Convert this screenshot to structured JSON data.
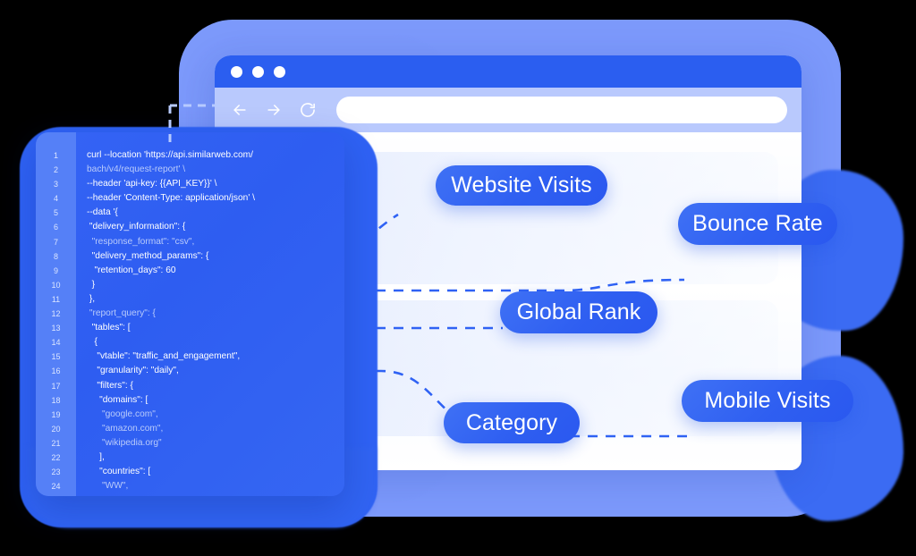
{
  "browser": {
    "traffic_lights": [
      "close",
      "minimize",
      "maximize"
    ],
    "nav": {
      "back_label": "Back",
      "forward_label": "Forward",
      "reload_label": "Reload"
    },
    "address_bar": {
      "value": "",
      "placeholder": ""
    }
  },
  "pills": [
    {
      "id": "website-visits",
      "label": "Website Visits"
    },
    {
      "id": "bounce-rate",
      "label": "Bounce Rate"
    },
    {
      "id": "global-rank",
      "label": "Global Rank"
    },
    {
      "id": "category",
      "label": "Category"
    },
    {
      "id": "mobile-visits",
      "label": "Mobile Visits"
    }
  ],
  "code_panel": {
    "language": "shell",
    "line_numbers": [
      1,
      2,
      3,
      4,
      5,
      6,
      7,
      8,
      9,
      10,
      11,
      12,
      13,
      14,
      15,
      16,
      17,
      18,
      19,
      20,
      21,
      22,
      23,
      24
    ],
    "lines": [
      {
        "n": 1,
        "text": "curl --location 'https://api.similarweb.com/",
        "dim": false
      },
      {
        "n": 2,
        "text": "bach/v4/request-report' \\",
        "dim": true
      },
      {
        "n": 3,
        "text": "--header 'api-key: {{API_KEY}}' \\",
        "dim": false
      },
      {
        "n": 4,
        "text": "--header 'Content-Type: application/json' \\",
        "dim": false
      },
      {
        "n": 5,
        "text": "--data '{",
        "dim": false
      },
      {
        "n": 6,
        "text": " \"delivery_information\": {",
        "dim": false
      },
      {
        "n": 7,
        "text": "  \"response_format\": \"csv\",",
        "dim": true
      },
      {
        "n": 8,
        "text": "  \"delivery_method_params\": {",
        "dim": false
      },
      {
        "n": 9,
        "text": "   \"retention_days\": 60",
        "dim": false
      },
      {
        "n": 10,
        "text": "  }",
        "dim": false
      },
      {
        "n": 11,
        "text": " },",
        "dim": false
      },
      {
        "n": 12,
        "text": " \"report_query\": {",
        "dim": true
      },
      {
        "n": 13,
        "text": "  \"tables\": [",
        "dim": false
      },
      {
        "n": 14,
        "text": "   {",
        "dim": false
      },
      {
        "n": 15,
        "text": "    \"vtable\": \"traffic_and_engagement\",",
        "dim": false
      },
      {
        "n": 16,
        "text": "    \"granularity\": \"daily\",",
        "dim": false
      },
      {
        "n": 17,
        "text": "    \"filters\": {",
        "dim": false
      },
      {
        "n": 18,
        "text": "     \"domains\": [",
        "dim": false
      },
      {
        "n": 19,
        "text": "      \"google.com\",",
        "dim": true
      },
      {
        "n": 20,
        "text": "      \"amazon.com\",",
        "dim": true
      },
      {
        "n": 21,
        "text": "      \"wikipedia.org\"",
        "dim": true
      },
      {
        "n": 22,
        "text": "     ],",
        "dim": false
      },
      {
        "n": 23,
        "text": "     \"countries\": [",
        "dim": false
      },
      {
        "n": 24,
        "text": "      \"WW\",",
        "dim": true
      }
    ]
  },
  "colors": {
    "brand_blue": "#2b5ef0",
    "pill_blue": "#2f5ff1",
    "toolbar_blue": "#b9c9fd",
    "backdrop_blue": "#7c99fb",
    "code_blue": "#2e5ff2",
    "gutter_blue": "#5580f7",
    "dash_blue": "#2f62f4",
    "text_white": "#ffffff",
    "text_dim": "#b9cbfb"
  }
}
